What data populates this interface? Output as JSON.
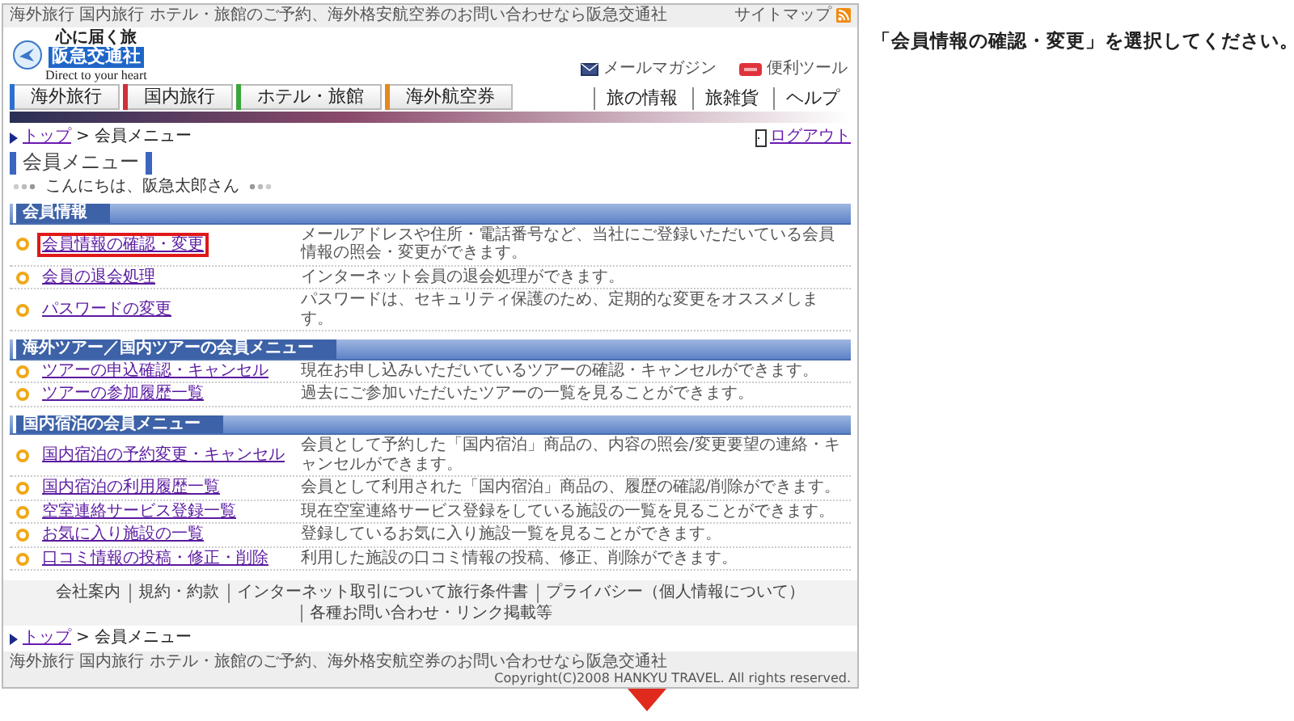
{
  "header": {
    "tagline": "海外旅行 国内旅行 ホテル・旅館のご予約、海外格安航空券のお問い合わせなら阪急交通社",
    "sitemap": "サイトマップ",
    "logo_catch": "心に届く旅",
    "logo_name": "阪急交通社",
    "logo_sub": "Direct to your heart",
    "links": [
      {
        "kind": "mail",
        "label": "メールマガジン"
      },
      {
        "kind": "new",
        "label": "便利ツール"
      }
    ]
  },
  "main_tabs": [
    {
      "label": "海外旅行",
      "color": "#2f6fd0"
    },
    {
      "label": "国内旅行",
      "color": "#d0303a"
    },
    {
      "label": "ホテル・旅館",
      "color": "#3aa53a"
    },
    {
      "label": "海外航空券",
      "color": "#e08a20"
    }
  ],
  "sub_tabs": [
    "旅の情報",
    "旅雑貨",
    "ヘルプ"
  ],
  "breadcrumb": {
    "link": "トップ",
    "separator": ">",
    "current": "会員メニュー"
  },
  "logout": "ログアウト",
  "title": "会員メニュー",
  "greeting": "こんにちは、阪急太郎さん",
  "sections": [
    {
      "title": "会員情報",
      "items": [
        {
          "label": "会員情報の確認・変更",
          "description": "メールアドレスや住所・電話番号など、当社にご登録いただいている会員情報の照会・変更ができます。",
          "highlighted": true
        },
        {
          "label": "会員の退会処理",
          "description": "インターネット会員の退会処理ができます。",
          "highlighted": false
        },
        {
          "label": "パスワードの変更",
          "description": "パスワードは、セキュリティ保護のため、定期的な変更をオススメします。",
          "highlighted": false
        }
      ]
    },
    {
      "title": "海外ツアー／国内ツアーの会員メニュー",
      "items": [
        {
          "label": "ツアーの申込確認・キャンセル",
          "description": "現在お申し込みいただいているツアーの確認・キャンセルができます。",
          "highlighted": false
        },
        {
          "label": "ツアーの参加履歴一覧",
          "description": "過去にご参加いただいたツアーの一覧を見ることができます。",
          "highlighted": false
        }
      ]
    },
    {
      "title": "国内宿泊の会員メニュー",
      "items": [
        {
          "label": "国内宿泊の予約変更・キャンセル",
          "description": "会員として予約した「国内宿泊」商品の、内容の照会/変更要望の連絡・キャンセルができます。",
          "highlighted": false
        },
        {
          "label": "国内宿泊の利用履歴一覧",
          "description": "会員として利用された「国内宿泊」商品の、履歴の確認/削除ができます。",
          "highlighted": false
        },
        {
          "label": "空室連絡サービス登録一覧",
          "description": "現在空室連絡サービス登録をしている施設の一覧を見ることができます。",
          "highlighted": false
        },
        {
          "label": "お気に入り施設の一覧",
          "description": "登録しているお気に入り施設一覧を見ることができます。",
          "highlighted": false
        },
        {
          "label": "口コミ情報の投稿・修正・削除",
          "description": "利用した施設の口コミ情報の投稿、修正、削除ができます。",
          "highlighted": false
        }
      ]
    }
  ],
  "footer_links": [
    "会社案内",
    "規約・約款",
    "インターネット取引について旅行条件書",
    "プライバシー（個人情報について）",
    "各種お問い合わせ・リンク掲載等"
  ],
  "bottom_breadcrumb": {
    "link": "トップ",
    "separator": ">",
    "current": "会員メニュー"
  },
  "bottom_tagline": "海外旅行 国内旅行 ホテル・旅館のご予約、海外格安航空券のお問い合わせなら阪急交通社",
  "copyright": "Copyright(C)2008 HANKYU TRAVEL. All rights reserved.",
  "instruction": "「会員情報の確認・変更」を選択してください。"
}
